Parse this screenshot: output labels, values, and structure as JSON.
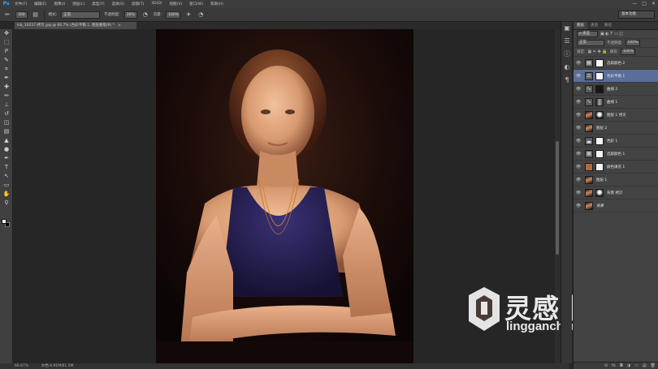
{
  "app": {
    "logo": "Ps"
  },
  "menu": [
    "文件(F)",
    "编辑(E)",
    "图像(I)",
    "图层(L)",
    "类型(Y)",
    "选择(S)",
    "滤镜(T)",
    "3D(D)",
    "视图(V)",
    "窗口(W)",
    "帮助(H)"
  ],
  "window_controls": {
    "minimize": "—",
    "maximize": "□",
    "close": "✕"
  },
  "options": {
    "brush_size": "300",
    "mode_label": "模式:",
    "mode_value": "正常",
    "opacity_label": "不透明度:",
    "opacity_value": "36%",
    "flow_label": "流量:",
    "flow_value": "100%",
    "workspace": "基本功能"
  },
  "document": {
    "tab_title": "lsb_10237-拷贝.jpg @ 66.7% (色彩平衡 1, 图层蒙版/8) *",
    "tab_close": "×",
    "zoom_status": "66.67%",
    "doc_status": "文档:4.91M/61.5M"
  },
  "icons": {
    "tools": [
      "move-icon",
      "marquee-icon",
      "lasso-icon",
      "quick-select-icon",
      "crop-icon",
      "eyedropper-icon",
      "healing-icon",
      "brush-icon",
      "stamp-icon",
      "history-brush-icon",
      "eraser-icon",
      "gradient-icon",
      "blur-icon",
      "dodge-icon",
      "pen-icon",
      "type-icon",
      "path-select-icon",
      "rectangle-icon",
      "hand-icon",
      "zoom-icon"
    ],
    "tool_glyphs": [
      "✥",
      "⬚",
      "ᑭ",
      "✎",
      "⌗",
      "✒",
      "✚",
      "✏",
      "⊥",
      "↺",
      "◫",
      "▤",
      "▲",
      "●",
      "✒",
      "T",
      "↖",
      "▭",
      "✋",
      "⚲"
    ],
    "mini_panels": [
      "history-icon",
      "properties-icon",
      "info-icon",
      "adjustments-icon",
      "paragraph-icon"
    ],
    "mini_glyphs": [
      "▣",
      "☰",
      "ⓘ",
      "◐",
      "¶"
    ]
  },
  "layers_panel": {
    "tabs": [
      "图层",
      "通道",
      "路径"
    ],
    "kind_filter": "ρ 类型",
    "blend_mode": "正常",
    "opacity_label": "不透明度:",
    "opacity_value": "100%",
    "lock_label": "锁定:",
    "fill_label": "填充:",
    "fill_value": "100%",
    "footer_icons": [
      "⊝",
      "fx",
      "◘",
      "◑",
      "▭",
      "▤",
      "🗑"
    ],
    "layers": [
      {
        "name": "选取颜色 2",
        "thumb": "adj",
        "glyph": "▦",
        "mask": true,
        "selected": false,
        "italic": false
      },
      {
        "name": "色彩平衡 1",
        "thumb": "adj",
        "glyph": "⚖",
        "mask": true,
        "selected": true,
        "italic": false
      },
      {
        "name": "曲线 2",
        "thumb": "adj",
        "glyph": "∿",
        "mask": "dark",
        "selected": false,
        "italic": false
      },
      {
        "name": "曲线 1",
        "thumb": "adj",
        "glyph": "∿",
        "mask": "gray",
        "selected": false,
        "italic": false
      },
      {
        "name": "图层 1 拷贝",
        "thumb": "photo",
        "glyph": "",
        "mask": "portrait",
        "selected": false,
        "italic": false
      },
      {
        "name": "图层 2",
        "thumb": "photo",
        "glyph": "",
        "mask": false,
        "selected": false,
        "italic": false
      },
      {
        "name": "色阶 1",
        "thumb": "adj",
        "glyph": "▃",
        "mask": true,
        "selected": false,
        "italic": false
      },
      {
        "name": "选取颜色 1",
        "thumb": "adj",
        "glyph": "▦",
        "mask": true,
        "selected": false,
        "italic": false
      },
      {
        "name": "颜色填充 1",
        "thumb": "fill",
        "glyph": "",
        "mask": true,
        "selected": false,
        "italic": false
      },
      {
        "name": "图层 1",
        "thumb": "photo",
        "glyph": "",
        "mask": false,
        "selected": false,
        "italic": false
      },
      {
        "name": "背景 拷贝",
        "thumb": "photo",
        "glyph": "",
        "mask": "portrait",
        "selected": false,
        "italic": false
      },
      {
        "name": "背景",
        "thumb": "photo",
        "glyph": "",
        "mask": false,
        "selected": false,
        "italic": true
      }
    ]
  },
  "watermark": {
    "cn": "灵感中国",
    "url": "lingganchina.com"
  }
}
